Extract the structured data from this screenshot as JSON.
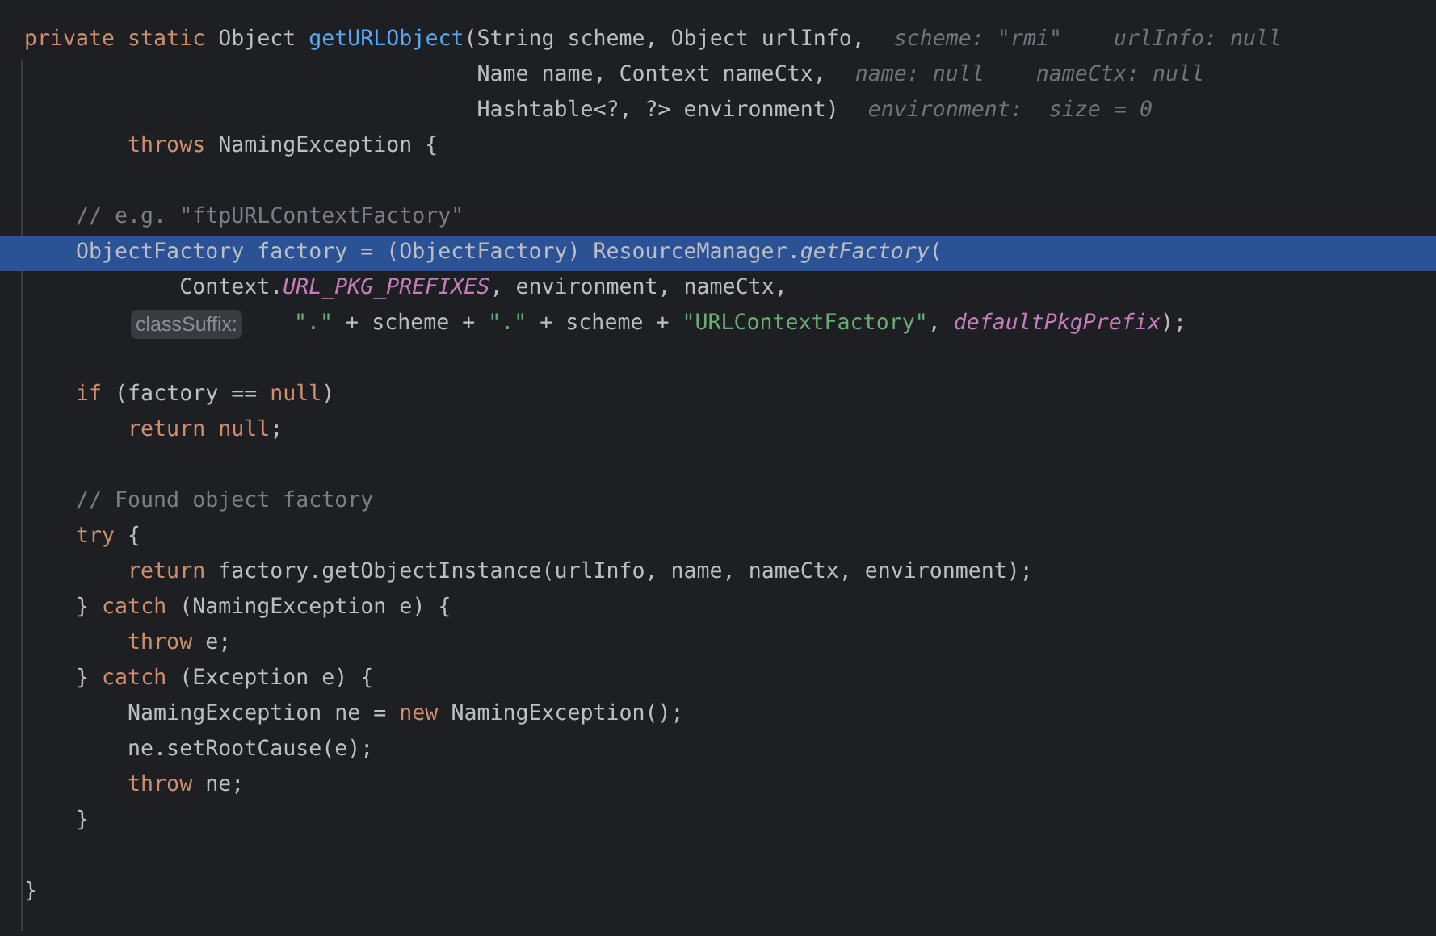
{
  "editor": {
    "lines": [
      {
        "selected": false,
        "tokens": [
          {
            "t": "private static ",
            "kind": "kw"
          },
          {
            "t": "Object ",
            "kind": "p"
          },
          {
            "t": "getURLObject",
            "kind": "fn"
          },
          {
            "t": "(String scheme, Object urlInfo,",
            "kind": "p"
          },
          {
            "t": "scheme: \"rmi\"",
            "kind": "hint"
          },
          {
            "t": "urlInfo: null",
            "kind": "hint"
          }
        ]
      },
      {
        "selected": false,
        "tokens": [
          {
            "t": "                                   Name name, Context nameCtx,",
            "kind": "p"
          },
          {
            "t": "name: null",
            "kind": "hint"
          },
          {
            "t": "nameCtx: null",
            "kind": "hint"
          }
        ]
      },
      {
        "selected": false,
        "tokens": [
          {
            "t": "                                   Hashtable<?, ?> environment)",
            "kind": "p"
          },
          {
            "t": "environment:  size = 0",
            "kind": "hint"
          }
        ]
      },
      {
        "selected": false,
        "tokens": [
          {
            "t": "        throws ",
            "kind": "kw"
          },
          {
            "t": "NamingException {",
            "kind": "p"
          }
        ]
      },
      {
        "selected": false
      },
      {
        "selected": false,
        "tokens": [
          {
            "t": "    // e.g. \"ftpURLContextFactory\"",
            "kind": "cmt"
          }
        ]
      },
      {
        "selected": true,
        "tokens": [
          {
            "t": "    ObjectFactory factory = (ObjectFactory) ResourceManager.",
            "kind": "p"
          },
          {
            "t": "getFactory",
            "kind": "call"
          },
          {
            "t": "(",
            "kind": "p"
          }
        ]
      },
      {
        "selected": false,
        "tokens": [
          {
            "t": "            Context.",
            "kind": "p"
          },
          {
            "t": "URL_PKG_PREFIXES",
            "kind": "const"
          },
          {
            "t": ", environment, nameCtx,",
            "kind": "p"
          }
        ]
      },
      {
        "selected": false,
        "tokens": [
          {
            "t": "classSuffix:",
            "kind": "chip"
          },
          {
            "t": "    \".\"",
            "kind": "str"
          },
          {
            "t": " + scheme + ",
            "kind": "p"
          },
          {
            "t": "\".\"",
            "kind": "str"
          },
          {
            "t": " + scheme + ",
            "kind": "p"
          },
          {
            "t": "\"URLContextFactory\"",
            "kind": "str"
          },
          {
            "t": ", ",
            "kind": "p"
          },
          {
            "t": "defaultPkgPrefix",
            "kind": "const"
          },
          {
            "t": ");",
            "kind": "p"
          }
        ]
      },
      {
        "selected": false
      },
      {
        "selected": false,
        "tokens": [
          {
            "t": "    if ",
            "kind": "kw"
          },
          {
            "t": "(factory == ",
            "kind": "p"
          },
          {
            "t": "null",
            "kind": "kw"
          },
          {
            "t": ")",
            "kind": "p"
          }
        ]
      },
      {
        "selected": false,
        "tokens": [
          {
            "t": "        return null",
            "kind": "kw"
          },
          {
            "t": ";",
            "kind": "p"
          }
        ]
      },
      {
        "selected": false
      },
      {
        "selected": false,
        "tokens": [
          {
            "t": "    // Found object factory",
            "kind": "cmt"
          }
        ]
      },
      {
        "selected": false,
        "tokens": [
          {
            "t": "    try ",
            "kind": "kw"
          },
          {
            "t": "{",
            "kind": "p"
          }
        ]
      },
      {
        "selected": false,
        "tokens": [
          {
            "t": "        return ",
            "kind": "kw"
          },
          {
            "t": "factory.getObjectInstance(urlInfo, name, nameCtx, environment);",
            "kind": "p"
          }
        ]
      },
      {
        "selected": false,
        "tokens": [
          {
            "t": "    } ",
            "kind": "p"
          },
          {
            "t": "catch ",
            "kind": "kw"
          },
          {
            "t": "(NamingException e) {",
            "kind": "p"
          }
        ]
      },
      {
        "selected": false,
        "tokens": [
          {
            "t": "        throw ",
            "kind": "kw"
          },
          {
            "t": "e;",
            "kind": "p"
          }
        ]
      },
      {
        "selected": false,
        "tokens": [
          {
            "t": "    } ",
            "kind": "p"
          },
          {
            "t": "catch ",
            "kind": "kw"
          },
          {
            "t": "(Exception e) {",
            "kind": "p"
          }
        ]
      },
      {
        "selected": false,
        "tokens": [
          {
            "t": "        NamingException ne = ",
            "kind": "p"
          },
          {
            "t": "new ",
            "kind": "kw"
          },
          {
            "t": "NamingException();",
            "kind": "p"
          }
        ]
      },
      {
        "selected": false,
        "tokens": [
          {
            "t": "        ne.setRootCause(e);",
            "kind": "p"
          }
        ]
      },
      {
        "selected": false,
        "tokens": [
          {
            "t": "        throw ",
            "kind": "kw"
          },
          {
            "t": "ne;",
            "kind": "p"
          }
        ]
      },
      {
        "selected": false,
        "tokens": [
          {
            "t": "    }",
            "kind": "p"
          }
        ]
      },
      {
        "selected": false
      },
      {
        "selected": false,
        "tokens": [
          {
            "t": "}",
            "kind": "p"
          }
        ]
      }
    ]
  }
}
